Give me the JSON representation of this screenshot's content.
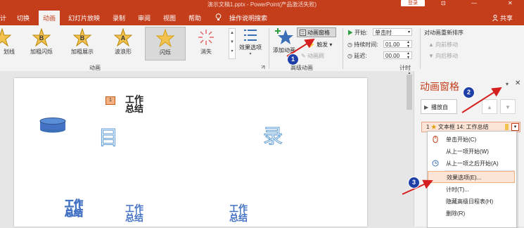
{
  "window": {
    "title": "演示文稿1.pptx - PowerPoint(产品激活失败)",
    "login_label": "登录",
    "restore_glyph": "⊡",
    "minimize_glyph": "—",
    "close_glyph": "✕"
  },
  "tabs": [
    {
      "label": "计",
      "active": false
    },
    {
      "label": "切换",
      "active": false
    },
    {
      "label": "动画",
      "active": true
    },
    {
      "label": "幻灯片放映",
      "active": false
    },
    {
      "label": "录制",
      "active": false
    },
    {
      "label": "审阅",
      "active": false
    },
    {
      "label": "视图",
      "active": false
    },
    {
      "label": "帮助",
      "active": false
    },
    {
      "label": "操作说明搜索",
      "active": false
    }
  ],
  "share_label": "共享",
  "ribbon": {
    "gallery": [
      {
        "label": "划线",
        "letter": "",
        "selected": false
      },
      {
        "label": "加粗闪烁",
        "letter": "B",
        "selected": false
      },
      {
        "label": "加粗展示",
        "letter": "B",
        "selected": false
      },
      {
        "label": "波浪形",
        "letter": "A",
        "selected": false
      },
      {
        "label": "闪烁",
        "letter": "",
        "selected": true
      },
      {
        "label": "消失",
        "letter": "",
        "selected": false
      }
    ],
    "effect_options_label": "效果选项",
    "group_animation_label": "动画",
    "add_animation_label": "添加动画",
    "animation_pane_label": "动画窗格",
    "trigger_label": "触发",
    "animation_painter_label": "动画刷",
    "group_advanced_label": "高级动画",
    "start_label": "开始:",
    "start_value": "单击时",
    "duration_label": "持续时间:",
    "duration_value": "01.00",
    "delay_label": "延迟:",
    "delay_value": "00.00",
    "group_timing_label": "计时",
    "reorder_label": "对动画重新排序",
    "move_earlier_label": "向前移动",
    "move_later_label": "向后移动"
  },
  "slide": {
    "badge": "1",
    "title_text": [
      "工作",
      "总结"
    ],
    "big_char_left": "目",
    "big_char_right": "录",
    "bottom_items": [
      [
        "工作",
        "总结"
      ],
      [
        "工作",
        "总结"
      ],
      [
        "工作",
        "总结"
      ]
    ]
  },
  "pane": {
    "title": "动画窗格",
    "play_label": "播放自",
    "item_number": "1",
    "item_label": "文本框 14: 工作总结"
  },
  "menu": [
    {
      "label": "单击开始(C)",
      "highlight": false
    },
    {
      "label": "从上一项开始(W)",
      "highlight": false
    },
    {
      "label": "从上一项之后开始(A)",
      "highlight": false
    },
    {
      "label": "效果选项(E)...",
      "highlight": true
    },
    {
      "label": "计时(T)...",
      "highlight": false
    },
    {
      "label": "隐藏高级日程表(H)",
      "highlight": false
    },
    {
      "label": "删除(R)",
      "highlight": false
    }
  ],
  "callouts": [
    "1",
    "2",
    "3"
  ],
  "colors": {
    "accent": "#c43e1c",
    "callout": "#1f3fa8",
    "arrow": "#d62020",
    "highlight": "#fce4d6"
  }
}
